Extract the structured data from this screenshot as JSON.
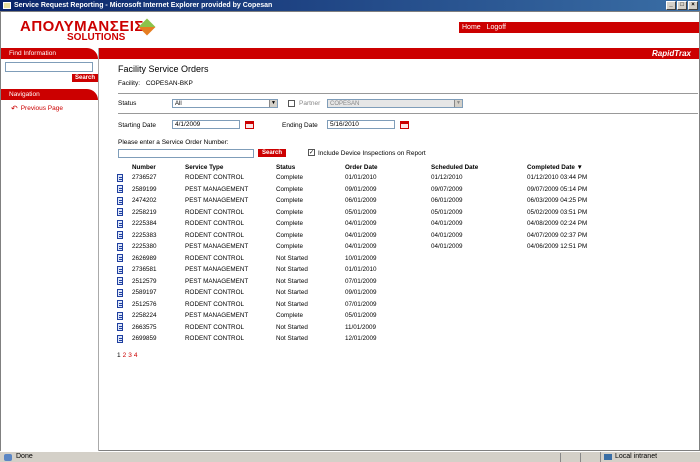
{
  "window": {
    "title": "Service Request Reporting - Microsoft Internet Explorer provided by Copesan"
  },
  "header": {
    "logo_main": "ΑΠΟΛΥΜΑΝΣΕΙΣ",
    "logo_sub": "SOLUTIONS",
    "nav_home": "Home",
    "nav_logoff": "Logoff",
    "brand": "RapidTrax"
  },
  "sidebar": {
    "find_title": "Find Information",
    "search_label": "Search",
    "nav_title": "Navigation",
    "previous_page": "Previous Page"
  },
  "main": {
    "title": "Facility Service Orders",
    "facility_label": "Facility:",
    "facility_value": "COPESAN-BKP",
    "status_label": "Status",
    "status_value": "All",
    "partner_label": "Partner",
    "partner_value": "COPESAN",
    "start_label": "Starting Date",
    "start_value": "4/1/2009",
    "end_label": "Ending Date",
    "end_value": "5/16/2010",
    "order_prompt": "Please enter a Service Order Number:",
    "search_button": "Search",
    "include_label": "Include Device Inspections on Report",
    "include_checked": "✓"
  },
  "table": {
    "headers": {
      "number": "Number",
      "type": "Service Type",
      "status": "Status",
      "order_date": "Order Date",
      "sched_date": "Scheduled Date",
      "completed": "Completed Date ▼"
    },
    "rows": [
      {
        "number": "2736527",
        "type": "RODENT CONTROL",
        "status": "Complete",
        "order": "01/01/2010",
        "sched": "01/12/2010",
        "completed": "01/12/2010  03:44 PM"
      },
      {
        "number": "2589199",
        "type": "PEST MANAGEMENT",
        "status": "Complete",
        "order": "09/01/2009",
        "sched": "09/07/2009",
        "completed": "09/07/2009 05:14 PM"
      },
      {
        "number": "2474202",
        "type": "PEST MANAGEMENT",
        "status": "Complete",
        "order": "06/01/2009",
        "sched": "06/01/2009",
        "completed": "06/03/2009 04:25 PM"
      },
      {
        "number": "2258219",
        "type": "RODENT CONTROL",
        "status": "Complete",
        "order": "05/01/2009",
        "sched": "05/01/2009",
        "completed": "05/02/2009 03:51 PM"
      },
      {
        "number": "2225384",
        "type": "RODENT CONTROL",
        "status": "Complete",
        "order": "04/01/2009",
        "sched": "04/01/2009",
        "completed": "04/08/2009 02:24 PM"
      },
      {
        "number": "2225383",
        "type": "RODENT CONTROL",
        "status": "Complete",
        "order": "04/01/2009",
        "sched": "04/01/2009",
        "completed": "04/07/2009 02:37 PM"
      },
      {
        "number": "2225380",
        "type": "PEST MANAGEMENT",
        "status": "Complete",
        "order": "04/01/2009",
        "sched": "04/01/2009",
        "completed": "04/06/2009 12:51 PM"
      },
      {
        "number": "2626989",
        "type": "RODENT CONTROL",
        "status": "Not Started",
        "order": "10/01/2009",
        "sched": "",
        "completed": ""
      },
      {
        "number": "2736581",
        "type": "PEST MANAGEMENT",
        "status": "Not Started",
        "order": "01/01/2010",
        "sched": "",
        "completed": ""
      },
      {
        "number": "2512579",
        "type": "PEST MANAGEMENT",
        "status": "Not Started",
        "order": "07/01/2009",
        "sched": "",
        "completed": ""
      },
      {
        "number": "2589197",
        "type": "RODENT CONTROL",
        "status": "Not Started",
        "order": "09/01/2009",
        "sched": "",
        "completed": ""
      },
      {
        "number": "2512576",
        "type": "RODENT CONTROL",
        "status": "Not Started",
        "order": "07/01/2009",
        "sched": "",
        "completed": ""
      },
      {
        "number": "2258224",
        "type": "PEST MANAGEMENT",
        "status": "Complete",
        "order": "05/01/2009",
        "sched": "",
        "completed": ""
      },
      {
        "number": "2663575",
        "type": "RODENT CONTROL",
        "status": "Not Started",
        "order": "11/01/2009",
        "sched": "",
        "completed": ""
      },
      {
        "number": "2699859",
        "type": "RODENT CONTROL",
        "status": "Not Started",
        "order": "12/01/2009",
        "sched": "",
        "completed": ""
      }
    ]
  },
  "pager": [
    "1",
    "2",
    "3",
    "4"
  ],
  "statusbar": {
    "done": "Done",
    "zone": "Local intranet"
  }
}
